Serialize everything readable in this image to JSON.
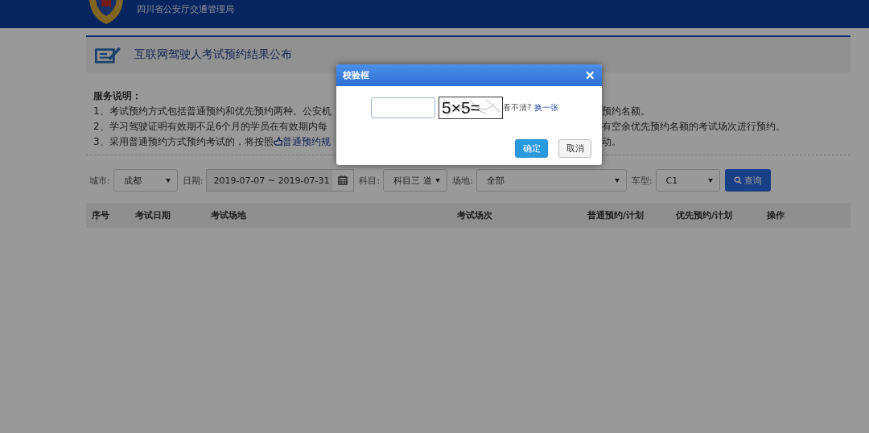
{
  "header": {
    "org_name": "四川省公安厅交通管理局"
  },
  "page_title": "互联网驾驶人考试预约结果公布",
  "service_notes": {
    "heading": "服务说明：",
    "lines": [
      {
        "left": "1、考试预约方式包括普通预约和优先预约两种。公安机",
        "right": "预约名额。"
      },
      {
        "left": "2、学习驾驶证明有效期不足6个月的学员在有效期内每",
        "right": "有空余优先预约名额的考试场次进行预约。"
      },
      {
        "left": "3、采用普通预约方式预约考试的，将按照",
        "link": "普通预约规",
        "right": "动。"
      }
    ]
  },
  "filters": [
    {
      "kind": "select",
      "label": "城市:",
      "value": "成都"
    },
    {
      "kind": "date",
      "label": "日期:",
      "value": "2019-07-07 ~ 2019-07-31"
    },
    {
      "kind": "select",
      "label": "科目:",
      "value": "科目三 道"
    },
    {
      "kind": "wide_select",
      "label": "场地:",
      "value": "全部"
    },
    {
      "kind": "select",
      "label": "车型:",
      "value": "C1"
    }
  ],
  "search_button": "查询",
  "table": {
    "columns": [
      "序号",
      "考试日期",
      "考试场地",
      "考试场次",
      "普通预约/计划",
      "优先预约/计划",
      "操作"
    ]
  },
  "dialog": {
    "title": "校验框",
    "close": "✕",
    "captcha": "5×5=",
    "hint": "看不清?",
    "refresh_link": "换一张",
    "buttons": [
      {
        "label": "确定",
        "kind": "primary"
      },
      {
        "label": "取消",
        "kind": "default"
      }
    ]
  }
}
